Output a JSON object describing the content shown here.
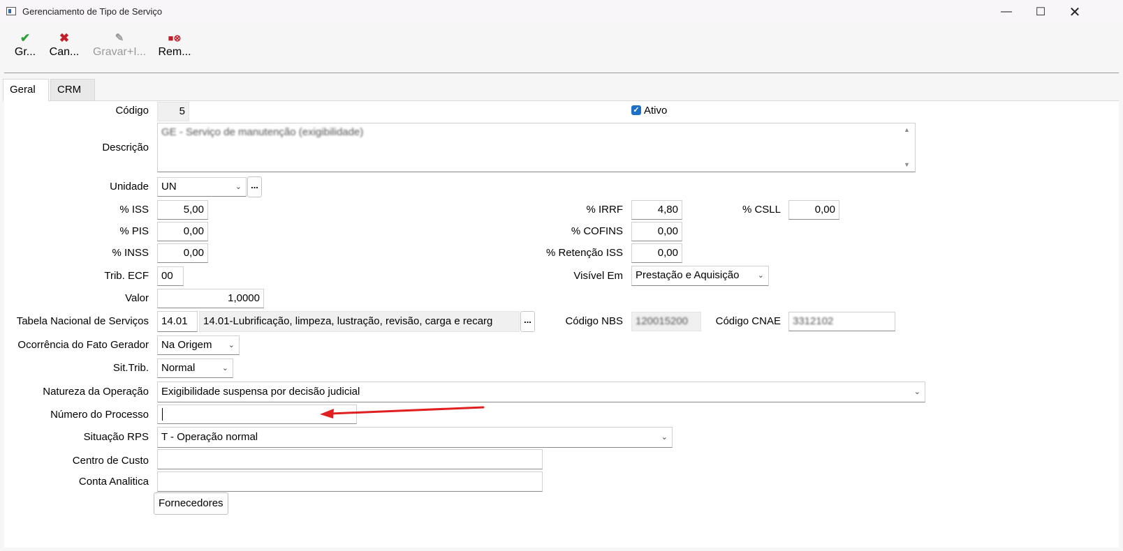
{
  "window": {
    "title": "Gerenciamento de Tipo de Serviço",
    "minimize_icon": "minimize-icon",
    "maximize_icon": "maximize-icon",
    "close_icon": "close-icon"
  },
  "toolbar": {
    "save_label": "Gr...",
    "cancel_label": "Can...",
    "save_new_label": "Gravar+I...",
    "remove_label": "Rem..."
  },
  "tabs": [
    {
      "label": "Geral",
      "active": true
    },
    {
      "label": "CRM",
      "active": false
    }
  ],
  "form": {
    "codigo": {
      "label": "Código",
      "value": "5"
    },
    "ativo": {
      "label": "Ativo",
      "checked": true
    },
    "descricao": {
      "label": "Descrição",
      "value": "GE - Serviço de manutenção (exigibilidade)"
    },
    "unidade": {
      "label": "Unidade",
      "value": "UN",
      "button": "..."
    },
    "iss": {
      "label": "% ISS",
      "value": "5,00"
    },
    "irrf": {
      "label": "% IRRF",
      "value": "4,80"
    },
    "csll": {
      "label": "% CSLL",
      "value": "0,00"
    },
    "pis": {
      "label": "% PIS",
      "value": "0,00"
    },
    "cofins": {
      "label": "% COFINS",
      "value": "0,00"
    },
    "inss": {
      "label": "% INSS",
      "value": "0,00"
    },
    "retencao_iss": {
      "label": "% Retenção ISS",
      "value": "0,00"
    },
    "trib_ecf": {
      "label": "Trib. ECF",
      "value": "00"
    },
    "visivel_em": {
      "label": "Visível Em",
      "value": "Prestação e Aquisição"
    },
    "valor": {
      "label": "Valor",
      "value": "1,0000"
    },
    "tabela_nacional": {
      "label": "Tabela Nacional de Serviços",
      "code": "14.01",
      "description": "14.01-Lubrificação, limpeza, lustração, revisão, carga e recarg",
      "button": "..."
    },
    "codigo_nbs": {
      "label": "Código NBS",
      "value": "120015200"
    },
    "codigo_cnae": {
      "label": "Código CNAE",
      "value": "3312102"
    },
    "ocorrencia": {
      "label": "Ocorrência do Fato Gerador",
      "value": "Na Origem"
    },
    "sit_trib": {
      "label": "Sit.Trib.",
      "value": "Normal"
    },
    "natureza": {
      "label": "Natureza da Operação",
      "value": "Exigibilidade suspensa por decisão judicial"
    },
    "numero_processo": {
      "label": "Número do Processo",
      "value": ""
    },
    "situacao_rps": {
      "label": "Situação RPS",
      "value": "T - Operação normal"
    },
    "centro_custo": {
      "label": "Centro de Custo",
      "value": ""
    },
    "conta_analitica": {
      "label": "Conta Analitica",
      "value": ""
    },
    "fornecedores_button": "Fornecedores"
  },
  "colors": {
    "accent_check": "#1e6fc8",
    "save_icon": "#2e9e3a",
    "cancel_icon": "#c0202a",
    "annotation_arrow": "#e02020"
  }
}
